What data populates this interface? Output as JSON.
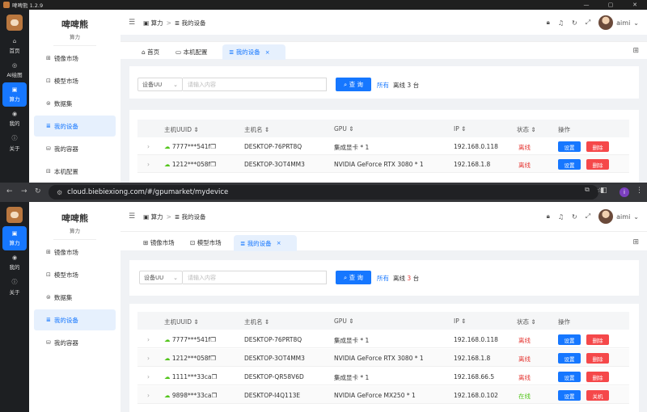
{
  "window": {
    "title": "啤啤熊 1.2.9",
    "controls": [
      "—",
      "▢",
      "✕"
    ]
  },
  "brand": {
    "name": "啤啤熊",
    "sub": "算力"
  },
  "leftnav_top": [
    {
      "label": "首页",
      "icon": "home-icon",
      "glyph": "⌂"
    },
    {
      "label": "AI绘图",
      "icon": "palette-icon",
      "glyph": "◎"
    },
    {
      "label": "算力",
      "icon": "chip-icon",
      "glyph": "▣"
    },
    {
      "label": "我的",
      "icon": "user-icon",
      "glyph": "◉"
    },
    {
      "label": "关于",
      "icon": "info-icon",
      "glyph": "ⓘ"
    }
  ],
  "leftnav_bottom": [
    {
      "label": "算力",
      "icon": "chip-icon",
      "glyph": "▣"
    },
    {
      "label": "我的",
      "icon": "user-icon",
      "glyph": "◉"
    },
    {
      "label": "关于",
      "icon": "info-icon",
      "glyph": "ⓘ"
    }
  ],
  "submenu": [
    {
      "label": "镜像市场",
      "icon": "grid-icon",
      "glyph": "⊞"
    },
    {
      "label": "模型市场",
      "icon": "model-icon",
      "glyph": "⊡"
    },
    {
      "label": "数据集",
      "icon": "database-icon",
      "glyph": "⊜"
    },
    {
      "label": "我的设备",
      "icon": "list-icon",
      "glyph": "≣"
    },
    {
      "label": "我的容器",
      "icon": "container-icon",
      "glyph": "⛁"
    },
    {
      "label": "本机配置",
      "icon": "settings-icon",
      "glyph": "⊟"
    }
  ],
  "breadcrumb": {
    "root": "算力",
    "sep": ">",
    "current": "我的设备"
  },
  "header": {
    "user": "aimi",
    "menu_glyph": "☰"
  },
  "tabs_top": [
    {
      "label": "首页",
      "glyph": "⌂"
    },
    {
      "label": "本机配置",
      "glyph": "▭"
    },
    {
      "label": "我的设备",
      "glyph": "≣",
      "close": "×"
    }
  ],
  "tabs_bottom": [
    {
      "label": "镜像市场",
      "glyph": "⊞"
    },
    {
      "label": "模型市场",
      "glyph": "⊡"
    },
    {
      "label": "我的设备",
      "glyph": "≣",
      "close": "×"
    }
  ],
  "search": {
    "select_top": "设备UU",
    "select_bottom": "设备UU",
    "placeholder": "请输入内容",
    "button": "查 询",
    "all_link": "所有",
    "offline_prefix": "离线",
    "offline_count": "3",
    "offline_suffix": "台"
  },
  "table": {
    "headers": [
      "主机UUID",
      "主机名",
      "GPU",
      "IP",
      "状态",
      "操作"
    ],
    "rows": [
      {
        "uuid": "7777***541f",
        "host": "DESKTOP-76PRT8Q",
        "gpu": "集成显卡 * 1",
        "ip": "192.168.0.118",
        "status": "离线",
        "online": false,
        "b1": "设置",
        "b2": "删除"
      },
      {
        "uuid": "1212***058f",
        "host": "DESKTOP-3OT4MM3",
        "gpu": "NVIDIA GeForce RTX 3080 * 1",
        "ip": "192.168.1.8",
        "status": "离线",
        "online": false,
        "b1": "设置",
        "b2": "删除"
      },
      {
        "uuid": "1111***33ca",
        "host": "DESKTOP-QR58V6D",
        "gpu": "集成显卡 * 1",
        "ip": "192.168.66.5",
        "status": "离线",
        "online": false,
        "b1": "设置",
        "b2": "删除"
      },
      {
        "uuid": "9898***33ca",
        "host": "DESKTOP-I4Q113E",
        "gpu": "NVIDIA GeForce MX250 * 1",
        "ip": "192.168.0.102",
        "status": "在线",
        "online": true,
        "b1": "设置",
        "b2": "关机"
      }
    ]
  },
  "browser": {
    "url": "cloud.biebiexiong.com/#/gpumarket/mydevice",
    "profile": "i"
  },
  "colors": {
    "primary": "#1677ff",
    "danger": "#f5484a",
    "online": "#52c41a",
    "sidebar": "#1d1f22"
  }
}
